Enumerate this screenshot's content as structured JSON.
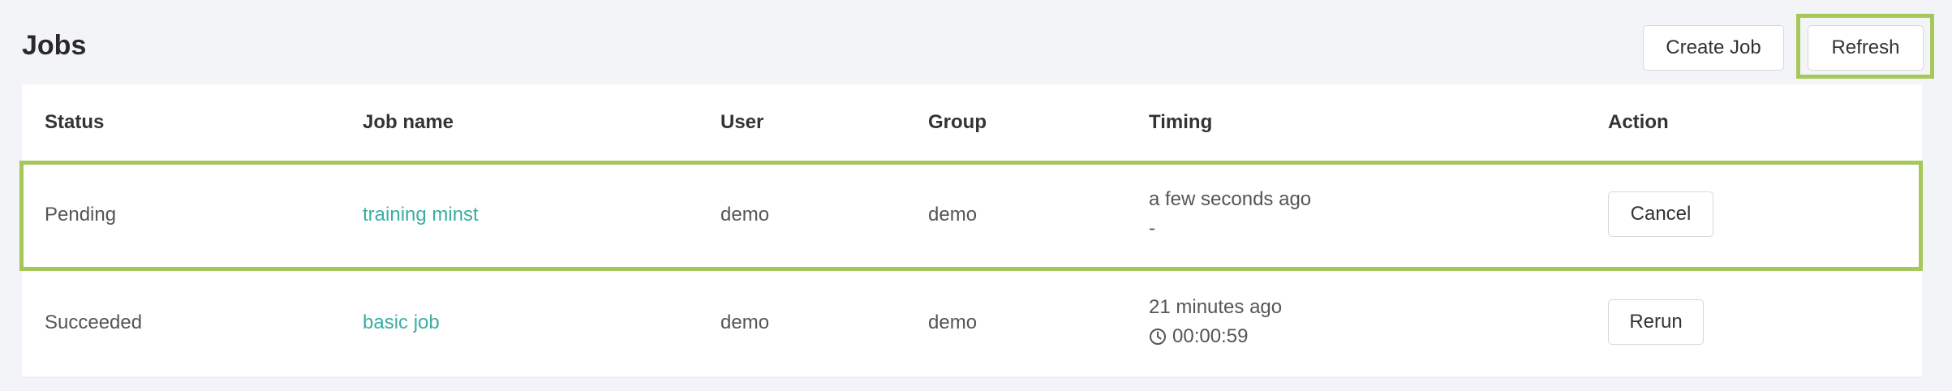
{
  "header": {
    "title": "Jobs",
    "create_label": "Create Job",
    "refresh_label": "Refresh"
  },
  "table": {
    "columns": [
      "Status",
      "Job name",
      "User",
      "Group",
      "Timing",
      "Action"
    ],
    "rows": [
      {
        "status": "Pending",
        "job_name": "training minst",
        "user": "demo",
        "group": "demo",
        "timing_started": "a few seconds ago",
        "timing_duration": "-",
        "action": "Cancel"
      },
      {
        "status": "Succeeded",
        "job_name": "basic job",
        "user": "demo",
        "group": "demo",
        "timing_started": "21 minutes ago",
        "timing_duration": "00:00:59",
        "action": "Rerun"
      }
    ]
  },
  "icons": {
    "duration": "clock-icon"
  },
  "colors": {
    "link": "#3aaea2",
    "highlight": "#a6c85a"
  }
}
